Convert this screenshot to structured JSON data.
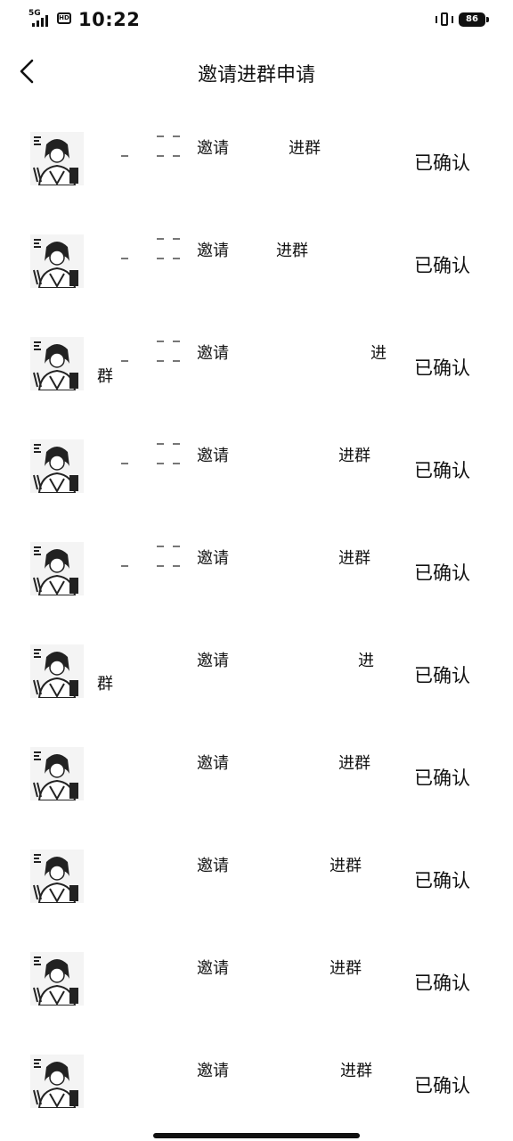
{
  "status_bar": {
    "network": "5G",
    "hd_label": "HD",
    "time": "10:22",
    "battery": "86"
  },
  "header": {
    "title": "邀请进群申请",
    "back_icon": "chevron-left-icon"
  },
  "requests": [
    {
      "invite_label": "邀请",
      "join_label": "进群",
      "wrap_label": "",
      "status": "已确认"
    },
    {
      "invite_label": "邀请",
      "join_label": "进群",
      "wrap_label": "",
      "status": "已确认"
    },
    {
      "invite_label": "邀请",
      "join_label": "进",
      "wrap_label": "群",
      "status": "已确认"
    },
    {
      "invite_label": "邀请",
      "join_label": "进群",
      "wrap_label": "",
      "status": "已确认"
    },
    {
      "invite_label": "邀请",
      "join_label": "进群",
      "wrap_label": "",
      "status": "已确认"
    },
    {
      "invite_label": "邀请",
      "join_label": "进",
      "wrap_label": "群",
      "status": "已确认"
    },
    {
      "invite_label": "邀请",
      "join_label": "进群",
      "wrap_label": "",
      "status": "已确认"
    },
    {
      "invite_label": "邀请",
      "join_label": "进群",
      "wrap_label": "",
      "status": "已确认"
    },
    {
      "invite_label": "邀请",
      "join_label": "进群",
      "wrap_label": "",
      "status": "已确认"
    },
    {
      "invite_label": "邀请",
      "join_label": "进群",
      "wrap_label": "",
      "status": "已确认"
    }
  ]
}
